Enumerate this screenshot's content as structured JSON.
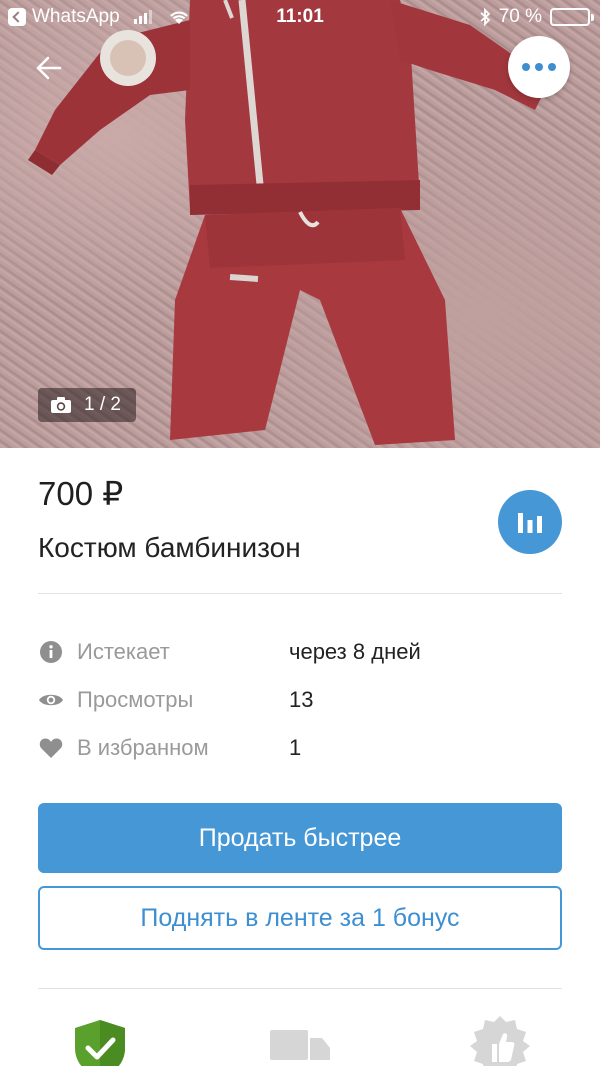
{
  "status_bar": {
    "back_app": "WhatsApp",
    "time": "11:01",
    "battery": "70 %",
    "battery_level": 0.7
  },
  "photo": {
    "counter": "1 / 2"
  },
  "listing": {
    "price": "700 ₽",
    "title": "Костюм бамбинизон"
  },
  "info": [
    {
      "icon": "info-icon",
      "label": "Истекает",
      "value": "через 8 дней"
    },
    {
      "icon": "eye-icon",
      "label": "Просмотры",
      "value": "13"
    },
    {
      "icon": "heart-icon",
      "label": "В избранном",
      "value": "1"
    }
  ],
  "actions": {
    "sell_faster": "Продать быстрее",
    "boost": "Поднять в ленте за 1 бонус"
  },
  "bottom_icons": [
    "shield-check-icon",
    "truck-icon",
    "thumbs-up-badge-icon"
  ],
  "colors": {
    "accent": "#4597d6",
    "garment": "#a83a3f",
    "shield": "#5aa02c"
  }
}
